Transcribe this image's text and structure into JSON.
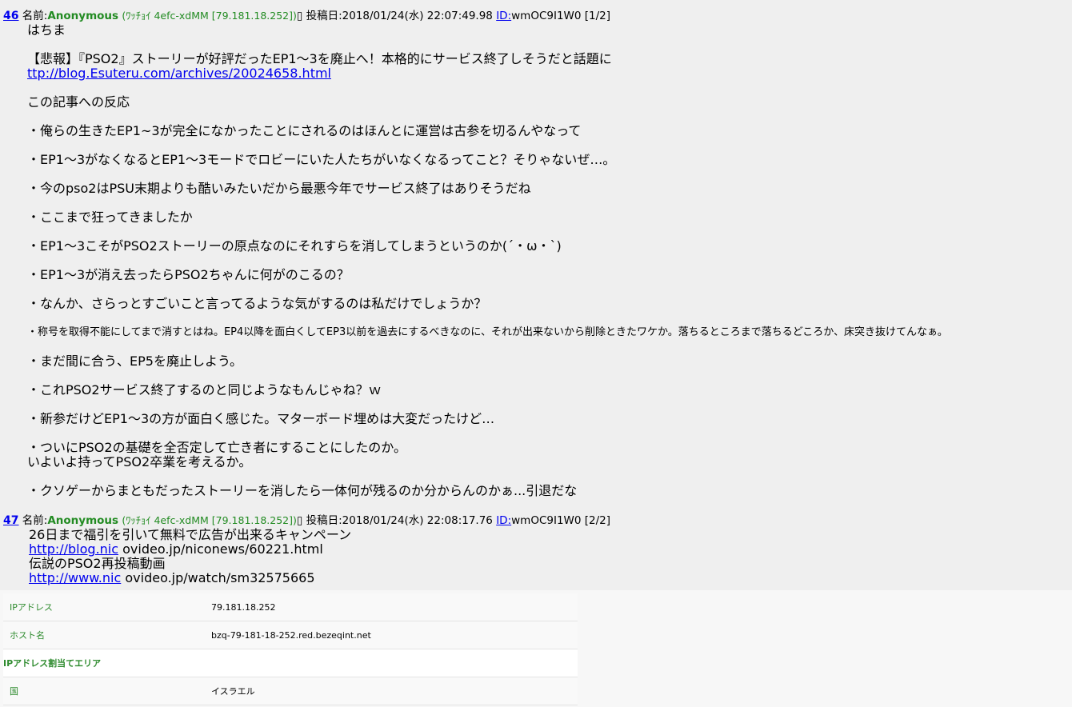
{
  "post1": {
    "number": "46",
    "name_label": "名前:",
    "name": "Anonymous",
    "trip": "(ﾜｯﾁｮｲ 4efc-xdMM [79.181.18.252])",
    "box": "▯",
    "date_label": "投稿日:",
    "date": "2018/01/24(水) 22:07:49.98",
    "id_label": "ID:",
    "id": "wmOC9I1W0",
    "page": "[1/2]",
    "lines": [
      "はちま",
      "",
      "【悲報】『PSO2』ストーリーが好評だったEP1～3を廃止へ！本格的にサービス終了しそうだと話題に",
      "",
      "この記事への反応",
      "",
      "・俺らの生きたEP1~3が完全になかったことにされるのはほんとに運営は古参を切るんやなって",
      "",
      "・EP1～3がなくなるとEP1～3モードでロビーにいた人たちがいなくなるってこと？そりゃないぜ…。",
      "",
      "・今のpso2はPSU末期よりも酷いみたいだから最悪今年でサービス終了はありそうだね",
      "",
      "・ここまで狂ってきましたか",
      "",
      "・EP1～3こそがPSO2ストーリーの原点なのにそれすらを消してしまうというのか(´・ω・`)",
      "",
      "・EP1～3が消え去ったらPSO2ちゃんに何がのこるの？",
      "",
      "・なんか、さらっとすごいこと言ってるような気がするのは私だけでしょうか？",
      "",
      "・称号を取得不能にしてまで消すとはね。EP4以降を面白くしてEP3以前を過去にするべきなのに、それが出来ないから削除ときたワケか。落ちるところまで落ちるどころか、床突き抜けてんなぁ。",
      "",
      "・まだ間に合う、EP5を廃止しよう。",
      "",
      "・これPSO2サービス終了するのと同じようなもんじゃね？ｗ",
      "",
      "・新参だけどEP1～3の方が面白く感じた。マターボード埋めは大変だったけど…",
      "",
      "・ついにPSO2の基礎を全否定して亡き者にすることにしたのか。",
      "いよいよ持ってPSO2卒業を考えるか。",
      "",
      "・クソゲーからまともだったストーリーを消したら一体何が残るのか分からんのかぁ...引退だな"
    ],
    "link": "ttp://blog.Esuteru.com/archives/20024658.html"
  },
  "post2": {
    "number": "47",
    "name_label": "名前:",
    "name": "Anonymous",
    "trip": "(ﾜｯﾁｮｲ 4efc-xdMM [79.181.18.252])",
    "box": "▯",
    "date_label": "投稿日:",
    "date": "2018/01/24(水) 22:08:17.76",
    "id_label": "ID:",
    "id": "wmOC9I1W0",
    "page": "[2/2]",
    "line1": "26日まで福引を引いて無料で広告が出来るキャンペーン",
    "link1a": "http://blog.nic",
    "link1b": " ovideo.jp/niconews/60221.html",
    "line2": "伝説のPSO2再投稿動画",
    "link2a": "http://www.nic",
    "link2b": " ovideo.jp/watch/sm32575665"
  },
  "info_table": {
    "rows": [
      {
        "key": "IPアドレス",
        "value": "79.181.18.252"
      },
      {
        "key": "ホスト名",
        "value": "bzq-79-181-18-252.red.bezeqint.net"
      }
    ],
    "section": "IPアドレス割当てエリア",
    "rows2": [
      {
        "key": "国",
        "value": "イスラエル"
      }
    ]
  }
}
